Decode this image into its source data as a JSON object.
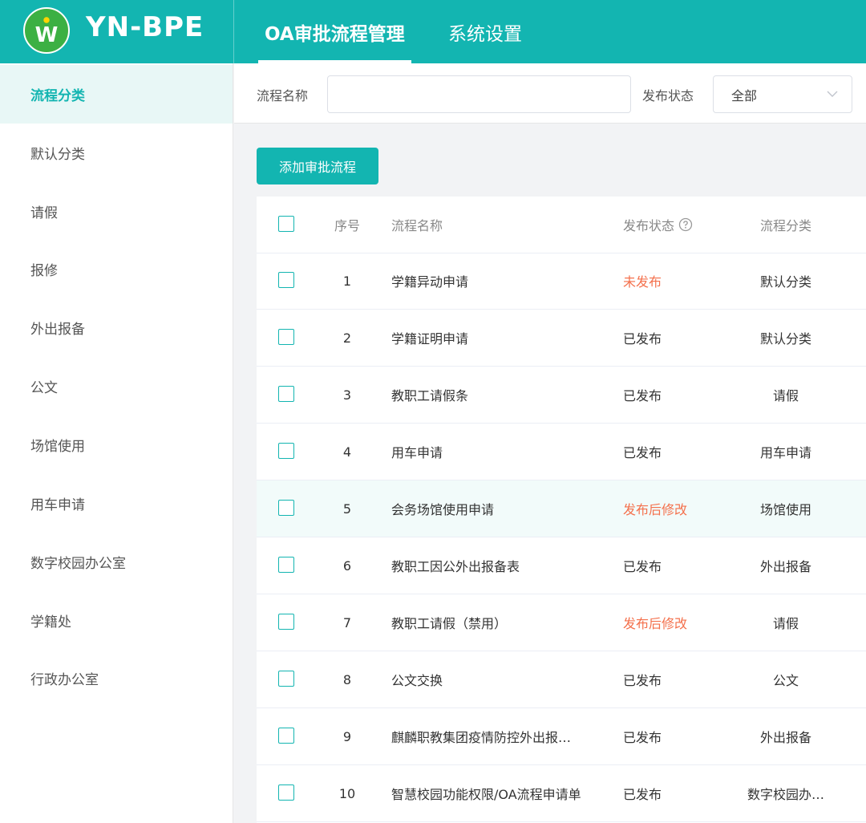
{
  "brand": {
    "name": "YN-BPE",
    "logo_letter": "W"
  },
  "nav": {
    "tabs": [
      {
        "label": "OA审批流程管理",
        "active": true
      },
      {
        "label": "系统设置",
        "active": false
      }
    ]
  },
  "sidebar": {
    "items": [
      {
        "label": "流程分类",
        "active": true
      },
      {
        "label": "默认分类"
      },
      {
        "label": "请假"
      },
      {
        "label": "报修"
      },
      {
        "label": "外出报备"
      },
      {
        "label": "公文"
      },
      {
        "label": "场馆使用"
      },
      {
        "label": "用车申请"
      },
      {
        "label": "数字校园办公室"
      },
      {
        "label": "学籍处"
      },
      {
        "label": "行政办公室"
      }
    ]
  },
  "filters": {
    "name_label": "流程名称",
    "name_value": "",
    "status_label": "发布状态",
    "status_selected": "全部"
  },
  "toolbar": {
    "add_label": "添加审批流程"
  },
  "table": {
    "headers": {
      "index": "序号",
      "name": "流程名称",
      "status": "发布状态",
      "category": "流程分类"
    },
    "rows": [
      {
        "index": "1",
        "name": "学籍异动申请",
        "status": "未发布",
        "status_color": "#f4704c",
        "category": "默认分类"
      },
      {
        "index": "2",
        "name": "学籍证明申请",
        "status": "已发布",
        "status_color": "#333333",
        "category": "默认分类"
      },
      {
        "index": "3",
        "name": "教职工请假条",
        "status": "已发布",
        "status_color": "#333333",
        "category": "请假"
      },
      {
        "index": "4",
        "name": "用车申请",
        "status": "已发布",
        "status_color": "#333333",
        "category": "用车申请"
      },
      {
        "index": "5",
        "name": "会务场馆使用申请",
        "status": "发布后修改",
        "status_color": "#f4704c",
        "category": "场馆使用"
      },
      {
        "index": "6",
        "name": "教职工因公外出报备表",
        "status": "已发布",
        "status_color": "#333333",
        "category": "外出报备"
      },
      {
        "index": "7",
        "name": "教职工请假（禁用）",
        "status": "发布后修改",
        "status_color": "#f4704c",
        "category": "请假"
      },
      {
        "index": "8",
        "name": "公文交换",
        "status": "已发布",
        "status_color": "#333333",
        "category": "公文"
      },
      {
        "index": "9",
        "name": "麒麟职教集团疫情防控外出报…",
        "status": "已发布",
        "status_color": "#333333",
        "category": "外出报备"
      },
      {
        "index": "10",
        "name": "智慧校园功能权限/OA流程申请单",
        "status": "已发布",
        "status_color": "#333333",
        "category": "数字校园办…"
      }
    ]
  },
  "colors": {
    "accent": "#13b5b1",
    "warning_text": "#f4704c",
    "logo_green": "#3cb043"
  }
}
